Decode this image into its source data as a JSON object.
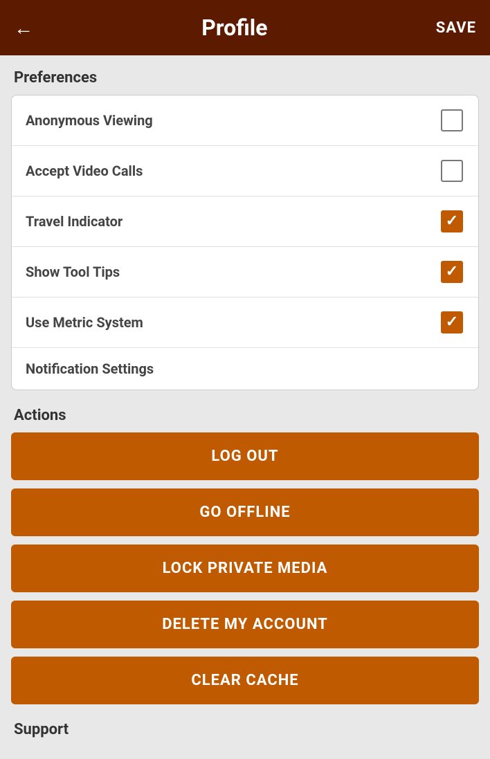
{
  "header": {
    "back_icon": "←",
    "title": "Profile",
    "save_label": "SAVE"
  },
  "preferences": {
    "section_label": "Preferences",
    "items": [
      {
        "label": "Anonymous Viewing",
        "checked": false
      },
      {
        "label": "Accept Video Calls",
        "checked": false
      },
      {
        "label": "Travel Indicator",
        "checked": true
      },
      {
        "label": "Show Tool Tips",
        "checked": true
      },
      {
        "label": "Use Metric System",
        "checked": true
      },
      {
        "label": "Notification Settings",
        "checked": null
      }
    ]
  },
  "actions": {
    "section_label": "Actions",
    "buttons": [
      {
        "label": "LOG OUT"
      },
      {
        "label": "GO OFFLINE"
      },
      {
        "label": "LOCK PRIVATE MEDIA"
      },
      {
        "label": "DELETE MY ACCOUNT"
      },
      {
        "label": "CLEAR CACHE"
      }
    ]
  },
  "support": {
    "section_label": "Support"
  }
}
